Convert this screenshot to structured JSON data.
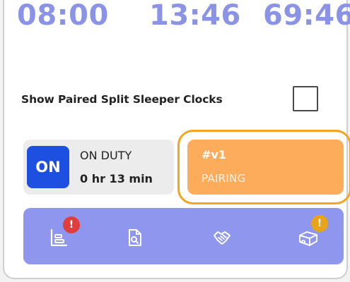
{
  "clocks": {
    "drive": "08:00",
    "shift": "13:46",
    "cycle": "69:46"
  },
  "paired_split": {
    "label": "Show Paired Split Sleeper Clocks",
    "checked": false
  },
  "duty": {
    "status_short": "ON",
    "status_label": "ON DUTY",
    "elapsed": "0 hr 13 min"
  },
  "vehicle": {
    "id": "#v1",
    "status": "PAIRING"
  },
  "actions": [
    {
      "icon": "logs-icon",
      "badge": "!"
    },
    {
      "icon": "document-search-icon",
      "badge": ""
    },
    {
      "icon": "handshake-icon",
      "badge": ""
    },
    {
      "icon": "trailer-icon",
      "badge": "!"
    }
  ],
  "colors": {
    "clock": "#8b93e6",
    "on_duty": "#1d4fe0",
    "pairing": "#fdac5b",
    "highlight": "#f2a61d",
    "action_bar": "#8e96ed",
    "badge_alert": "#e23d3d",
    "badge_warning": "#e8a318"
  }
}
